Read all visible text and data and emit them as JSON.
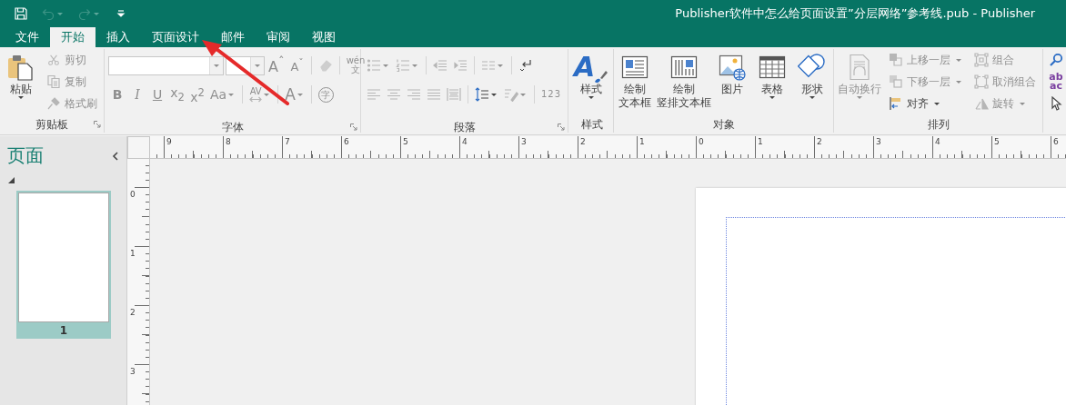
{
  "window": {
    "title": "Publisher软件中怎么给页面设置”分层网络”参考线.pub - Publisher"
  },
  "quick_access": [
    {
      "kind": "save",
      "disabled": false,
      "dropdown": false
    },
    {
      "kind": "undo",
      "disabled": true,
      "dropdown": true
    },
    {
      "kind": "redo",
      "disabled": true,
      "dropdown": true
    },
    {
      "kind": "customize",
      "disabled": false,
      "dropdown": false
    }
  ],
  "tabs": [
    {
      "label": "文件",
      "selected": false
    },
    {
      "label": "开始",
      "selected": true
    },
    {
      "label": "插入",
      "selected": false
    },
    {
      "label": "页面设计",
      "selected": false
    },
    {
      "label": "邮件",
      "selected": false
    },
    {
      "label": "审阅",
      "selected": false
    },
    {
      "label": "视图",
      "selected": false
    }
  ],
  "ribbon": {
    "groups": [
      {
        "label": "剪贴板",
        "launcher": true,
        "columns": [
          {
            "kind": "paste",
            "label": [
              "粘贴"
            ],
            "disabled": false,
            "dropdown": true
          },
          {
            "kind": "stack",
            "rows": [
              [
                {
                  "kind": "cut",
                  "label": "剪切",
                  "disabled": true,
                  "dropdown": false
                }
              ],
              [
                {
                  "kind": "copy",
                  "label": "复制",
                  "disabled": true,
                  "dropdown": false
                }
              ],
              [
                {
                  "kind": "format-painter",
                  "label": "格式刷",
                  "disabled": true,
                  "dropdown": false
                }
              ]
            ]
          }
        ]
      },
      {
        "label": "字体",
        "launcher": true,
        "columns": [
          {
            "kind": "stack",
            "rows": [
              [
                {
                  "kind": "font-name",
                  "disabled": true
                },
                {
                  "kind": "font-size",
                  "disabled": true
                },
                {
                  "kind": "grow-font",
                  "glyph": "A$^{ˆ}$",
                  "disabled": true,
                  "dropdown": false
                },
                {
                  "kind": "shrink-font",
                  "glyph": "A$^{ˇ}$",
                  "disabled": true,
                  "dropdown": false
                },
                {
                  "kind": "separator"
                },
                {
                  "kind": "clear-format",
                  "disabled": true,
                  "dropdown": false
                },
                {
                  "kind": "separator"
                },
                {
                  "kind": "phonetic-guide",
                  "glyph": "wén\n文",
                  "disabled": true,
                  "dropdown": false
                }
              ],
              [
                {
                  "kind": "bold",
                  "glyph": "B",
                  "disabled": true,
                  "dropdown": false
                },
                {
                  "kind": "italic",
                  "glyph": "I",
                  "disabled": true,
                  "dropdown": false
                },
                {
                  "kind": "underline",
                  "glyph": "U",
                  "disabled": true,
                  "dropdown": false
                },
                {
                  "kind": "subscript",
                  "glyph": "x$_{2}$",
                  "disabled": true,
                  "dropdown": false
                },
                {
                  "kind": "superscript",
                  "glyph": "x$^{2}$",
                  "disabled": true,
                  "dropdown": false
                },
                {
                  "kind": "change-case",
                  "glyph": "Aa",
                  "disabled": true,
                  "dropdown": true
                },
                {
                  "kind": "separator"
                },
                {
                  "kind": "character-spacing",
                  "glyph": "AV",
                  "disabled": true,
                  "dropdown": true
                },
                {
                  "kind": "separator"
                },
                {
                  "kind": "font-color",
                  "glyph": "A",
                  "disabled": true,
                  "dropdown": true
                },
                {
                  "kind": "separator"
                },
                {
                  "kind": "enclose-character",
                  "glyph": "字",
                  "disabled": true,
                  "dropdown": false
                }
              ]
            ]
          }
        ]
      },
      {
        "label": "段落",
        "launcher": true,
        "columns": [
          {
            "kind": "stack",
            "rows": [
              [
                {
                  "kind": "bullets",
                  "disabled": true,
                  "dropdown": true
                },
                {
                  "kind": "numbering",
                  "disabled": true,
                  "dropdown": true
                },
                {
                  "kind": "separator"
                },
                {
                  "kind": "decrease-indent",
                  "disabled": true,
                  "dropdown": false
                },
                {
                  "kind": "increase-indent",
                  "disabled": true,
                  "dropdown": false
                },
                {
                  "kind": "separator"
                },
                {
                  "kind": "columns",
                  "disabled": true,
                  "dropdown": true
                },
                {
                  "kind": "separator"
                },
                {
                  "kind": "line-break",
                  "disabled": false,
                  "dropdown": false
                }
              ],
              [
                {
                  "kind": "align-left",
                  "disabled": true,
                  "dropdown": false
                },
                {
                  "kind": "align-center",
                  "disabled": true,
                  "dropdown": false
                },
                {
                  "kind": "align-right",
                  "disabled": true,
                  "dropdown": false
                },
                {
                  "kind": "justify",
                  "disabled": true,
                  "dropdown": false
                },
                {
                  "kind": "distributed",
                  "disabled": true,
                  "dropdown": false
                },
                {
                  "kind": "separator"
                },
                {
                  "kind": "line-spacing",
                  "disabled": false,
                  "dropdown": true
                },
                {
                  "kind": "shading",
                  "disabled": true,
                  "dropdown": true
                },
                {
                  "kind": "separator"
                },
                {
                  "kind": "number-style",
                  "glyph": "123",
                  "disabled": true,
                  "dropdown": false
                }
              ]
            ]
          }
        ]
      },
      {
        "label": "样式",
        "launcher": false,
        "columns": [
          {
            "kind": "styles",
            "glyph": "A",
            "label": [
              "样式"
            ],
            "disabled": false,
            "dropdown": true
          }
        ]
      },
      {
        "label": "对象",
        "launcher": false,
        "columns": [
          {
            "kind": "text-box",
            "label": [
              "绘制",
              "文本框"
            ],
            "disabled": false,
            "dropdown": false
          },
          {
            "kind": "vertical-text-box",
            "label": [
              "绘制",
              "竖排文本框"
            ],
            "disabled": false,
            "dropdown": false
          },
          {
            "kind": "picture",
            "label": [
              "图片"
            ],
            "disabled": false,
            "dropdown": false
          },
          {
            "kind": "table",
            "label": [
              "表格"
            ],
            "disabled": false,
            "dropdown": true
          },
          {
            "kind": "shapes",
            "label": [
              "形状"
            ],
            "disabled": false,
            "dropdown": true
          }
        ]
      },
      {
        "label": "排列",
        "launcher": false,
        "columns": [
          {
            "kind": "wrap-text",
            "label": [
              "自动换行"
            ],
            "disabled": true,
            "dropdown": true
          },
          {
            "kind": "stack",
            "rows": [
              [
                {
                  "kind": "bring-forward",
                  "label": "上移一层",
                  "disabled": true,
                  "dropdown": true
                }
              ],
              [
                {
                  "kind": "send-backward",
                  "label": "下移一层",
                  "disabled": true,
                  "dropdown": true
                }
              ],
              [
                {
                  "kind": "align",
                  "label": "对齐",
                  "disabled": false,
                  "dropdown": true
                }
              ]
            ]
          },
          {
            "kind": "stack",
            "rows": [
              [
                {
                  "kind": "group",
                  "label": "组合",
                  "disabled": true,
                  "dropdown": false
                }
              ],
              [
                {
                  "kind": "ungroup",
                  "label": "取消组合",
                  "disabled": true,
                  "dropdown": false
                }
              ],
              [
                {
                  "kind": "rotate",
                  "label": "旋转",
                  "disabled": true,
                  "dropdown": true
                }
              ]
            ]
          }
        ]
      },
      {
        "columns": [
          {
            "kind": "stack",
            "rows": [
              [
                {
                  "kind": "find",
                  "disabled": false
                }
              ],
              [
                {
                  "kind": "replace",
                  "glyph": "ab\nac",
                  "disabled": false
                }
              ],
              [
                {
                  "kind": "select",
                  "disabled": false
                }
              ]
            ]
          }
        ]
      }
    ]
  },
  "pages_pane": {
    "title": "页面",
    "pages": [
      {
        "label": "1",
        "selected": true
      }
    ]
  },
  "rulers": {
    "horizontal": [
      "9",
      "8",
      "7",
      "6",
      "5",
      "4",
      "3",
      "2",
      "1",
      "0",
      "1",
      "2",
      "3",
      "4",
      "5",
      "6"
    ],
    "vertical": [
      "0",
      "1",
      "2",
      "3"
    ]
  }
}
